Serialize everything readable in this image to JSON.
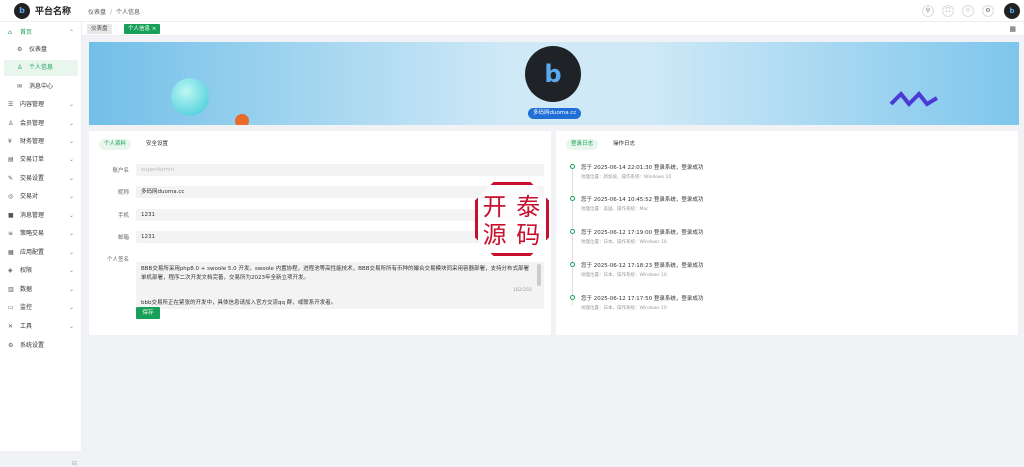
{
  "brand": {
    "title": "平台名称",
    "logo": "b"
  },
  "breadcrumb": {
    "home": "仪表盘",
    "sep": "/",
    "current": "个人信息"
  },
  "topbar_icons": [
    "search-icon",
    "fullscreen-icon",
    "bell-icon",
    "gear-icon"
  ],
  "sidebar": {
    "items": [
      {
        "label": "首页",
        "icon": "⌂"
      },
      {
        "label": "仪表盘",
        "icon": "⚙"
      },
      {
        "label": "个人信息",
        "icon": "♙"
      },
      {
        "label": "消息中心",
        "icon": "✉"
      },
      {
        "label": "内容管理",
        "icon": "☰"
      },
      {
        "label": "会员管理",
        "icon": "♙"
      },
      {
        "label": "财务管理",
        "icon": "¥"
      },
      {
        "label": "交易订单",
        "icon": "▤"
      },
      {
        "label": "交易设置",
        "icon": "✎"
      },
      {
        "label": "交易对",
        "icon": "◎"
      },
      {
        "label": "消息管理",
        "icon": "■"
      },
      {
        "label": "策略交易",
        "icon": "≡"
      },
      {
        "label": "应用配置",
        "icon": "▦"
      },
      {
        "label": "权限",
        "icon": "◈"
      },
      {
        "label": "数据",
        "icon": "▥"
      },
      {
        "label": "监控",
        "icon": "▭"
      },
      {
        "label": "工具",
        "icon": "✕"
      },
      {
        "label": "系统设置",
        "icon": "⚙"
      }
    ],
    "chevron": "⌄",
    "collapse": "⊟"
  },
  "tabs": [
    {
      "label": "仪表盘"
    },
    {
      "label": "个人信息",
      "close": "×"
    }
  ],
  "banner": {
    "username": "多码网duoma.cc",
    "avatar": "b"
  },
  "profile": {
    "tabs": [
      "个人资料",
      "安全设置"
    ],
    "fields": {
      "account_label": "账户名",
      "account_placeholder": "superAdmin",
      "nickname_label": "昵称",
      "nickname_value": "多码网duoma.cc",
      "phone_label": "手机",
      "phone_value": "1231",
      "email_label": "邮箱",
      "email_value": "1231",
      "sign_label": "个人签名",
      "sign_value": "BBB交易所采用php8.0 + swoole 5.0 开发。swoole 内置协程，进程池等高性能技术，BBB交易所所有币种的撮合交易模块同采用容器部署，支持分布式部署单机部署，程序二次开发文档完善，交易所为2023年全新立项开发。",
      "sign_value2": "bbb交易所正在紧张的开发中，具体信息请加入官方交流qq 群，或联系开发者。",
      "sign_count": "162/255"
    },
    "save": "保存"
  },
  "logs": {
    "tabs": [
      "登录日志",
      "操作日志"
    ],
    "items": [
      {
        "title": "您于 2025-06-14 22:01:30 登录系统，登录成功",
        "sub": "地理位置：新加坡，操作系统：Windows 10"
      },
      {
        "title": "您于 2025-06-14 10:45:52 登录系统，登录成功",
        "sub": "地理位置：美国，操作系统：Mac"
      },
      {
        "title": "您于 2025-06-12 17:19:00 登录系统，登录成功",
        "sub": "地理位置：日本，操作系统：Windows 10"
      },
      {
        "title": "您于 2025-06-12 17:18:23 登录系统，登录成功",
        "sub": "地理位置：日本，操作系统：Windows 10"
      },
      {
        "title": "您于 2025-06-12 17:17:50 登录系统，登录成功",
        "sub": "地理位置：日本，操作系统：Windows 10"
      }
    ]
  },
  "watermark": "开泰源码",
  "colors": {
    "accent": "#18a058",
    "stamp": "#c8102e",
    "badge": "#1f6fd6"
  }
}
